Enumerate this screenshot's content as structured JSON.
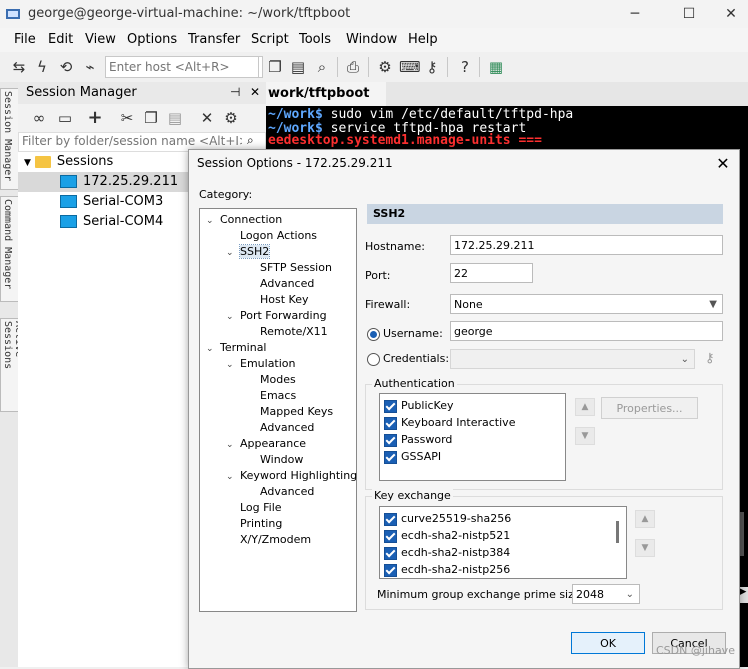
{
  "window": {
    "title": "george@george-virtual-machine: ~/work/tftpboot",
    "controls": {
      "minimize": "─",
      "maximize": "☐",
      "close": "✕"
    }
  },
  "menu": [
    "File",
    "Edit",
    "View",
    "Options",
    "Transfer",
    "Script",
    "Tools",
    "Window",
    "Help"
  ],
  "toolbar": {
    "host_placeholder": "Enter host <Alt+R>",
    "icons": [
      "connect-icon",
      "quick-connect-icon",
      "reconnect-icon",
      "disconnect-icon",
      "copy-icon",
      "paste-icon",
      "find-icon",
      "print-icon",
      "settings-icon",
      "keymap-icon",
      "key-icon",
      "help-icon",
      "sftp-icon"
    ]
  },
  "vertical_tabs": [
    "Session Manager",
    "Command Manager",
    "Active Sessions"
  ],
  "session_manager": {
    "title": "Session Manager",
    "pin_glyph": "⊣",
    "close_glyph": "✕",
    "filter_placeholder": "Filter by folder/session name <Alt+I>",
    "root": "Sessions",
    "sessions": [
      "172.25.29.211",
      "Serial-COM3",
      "Serial-COM4"
    ]
  },
  "terminal": {
    "tab_label": "work/tftpboot",
    "lines": [
      {
        "prompt": "~/work$",
        "cmd": " sudo vim /etc/default/tftpd-hpa"
      },
      {
        "prompt": "~/work$",
        "cmd": " service tftpd-hpa restart"
      },
      {
        "warn": "eedesktop.systemd1.manage-units ==="
      }
    ]
  },
  "dialog": {
    "title": "Session Options - 172.25.29.211",
    "close_glyph": "✕",
    "category_label": "Category:",
    "categories": [
      {
        "label": "Connection",
        "level": 0,
        "expanded": true
      },
      {
        "label": "Logon Actions",
        "level": 1
      },
      {
        "label": "SSH2",
        "level": 1,
        "expanded": true,
        "selected": true
      },
      {
        "label": "SFTP Session",
        "level": 2
      },
      {
        "label": "Advanced",
        "level": 2
      },
      {
        "label": "Host Key",
        "level": 2
      },
      {
        "label": "Port Forwarding",
        "level": 1,
        "expanded": true
      },
      {
        "label": "Remote/X11",
        "level": 2
      },
      {
        "label": "Terminal",
        "level": 0,
        "expanded": true
      },
      {
        "label": "Emulation",
        "level": 1,
        "expanded": true
      },
      {
        "label": "Modes",
        "level": 2
      },
      {
        "label": "Emacs",
        "level": 2
      },
      {
        "label": "Mapped Keys",
        "level": 2
      },
      {
        "label": "Advanced",
        "level": 2
      },
      {
        "label": "Appearance",
        "level": 1,
        "expanded": true
      },
      {
        "label": "Window",
        "level": 2
      },
      {
        "label": "Keyword Highlighting",
        "level": 1,
        "expanded": true
      },
      {
        "label": "Advanced",
        "level": 2
      },
      {
        "label": "Log File",
        "level": 1
      },
      {
        "label": "Printing",
        "level": 1
      },
      {
        "label": "X/Y/Zmodem",
        "level": 1
      }
    ],
    "section": "SSH2",
    "hostname_label": "Hostname:",
    "hostname": "172.25.29.211",
    "port_label": "Port:",
    "port": "22",
    "firewall_label": "Firewall:",
    "firewall": "None",
    "username_label": "Username:",
    "username": "george",
    "credentials_label": "Credentials:",
    "auth_label": "Authentication",
    "auth_methods": [
      "PublicKey",
      "Keyboard Interactive",
      "Password",
      "GSSAPI"
    ],
    "properties_button": "Properties...",
    "kex_label": "Key exchange",
    "kex_methods": [
      "curve25519-sha256",
      "ecdh-sha2-nistp521",
      "ecdh-sha2-nistp384",
      "ecdh-sha2-nistp256"
    ],
    "prime_label": "Minimum group exchange prime size:",
    "prime_value": "2048",
    "ok": "OK",
    "cancel": "Cancel"
  },
  "watermark": "CSDN @jihave"
}
